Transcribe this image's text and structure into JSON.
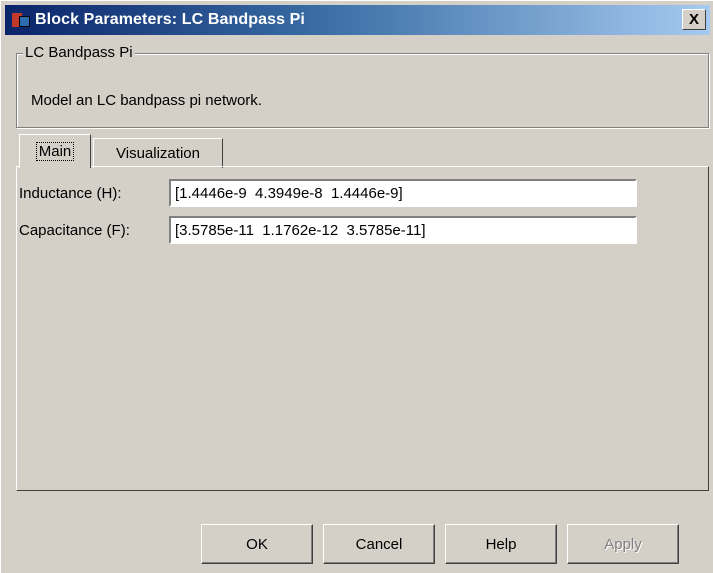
{
  "window": {
    "title": "Block Parameters: LC Bandpass Pi",
    "close_label": "X"
  },
  "group": {
    "legend": "LC Bandpass Pi",
    "description": "Model an LC bandpass pi network."
  },
  "tabs": [
    {
      "label": "Main",
      "active": true
    },
    {
      "label": "Visualization",
      "active": false
    }
  ],
  "fields": {
    "inductance": {
      "label": "Inductance (H):",
      "value": "[1.4446e-9  4.3949e-8  1.4446e-9]"
    },
    "capacitance": {
      "label": "Capacitance (F):",
      "value": "[3.5785e-11  1.1762e-12  3.5785e-11]"
    }
  },
  "buttons": {
    "ok": "OK",
    "cancel": "Cancel",
    "help": "Help",
    "apply": "Apply"
  },
  "icons": {
    "app": "simulink-block-icon",
    "close": "close-icon"
  }
}
